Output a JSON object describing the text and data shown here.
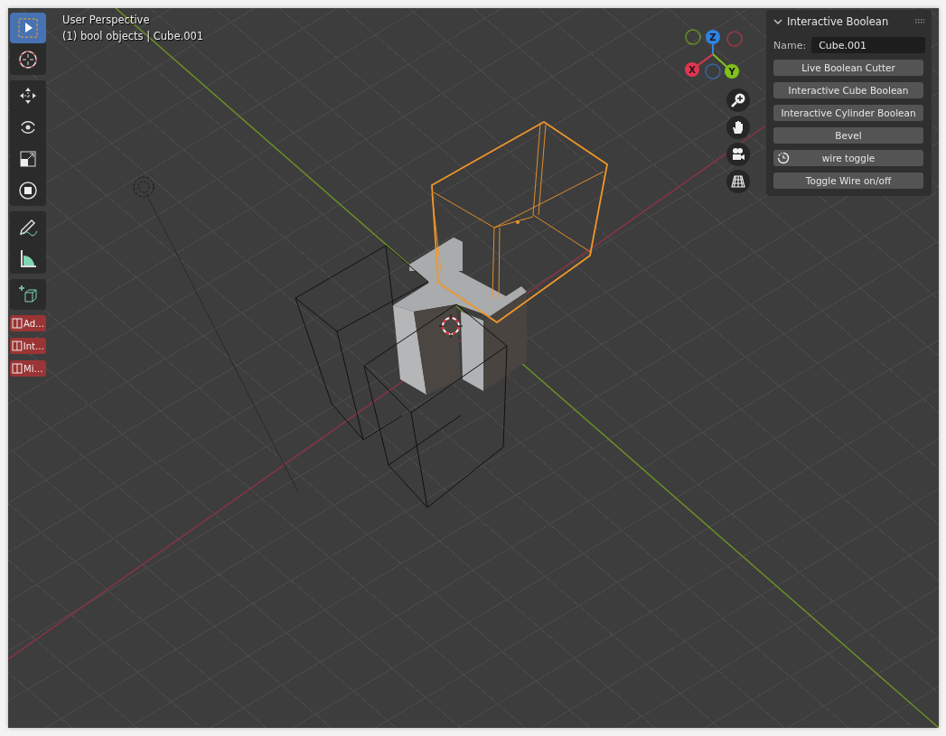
{
  "viewport": {
    "header": [
      "User Perspective",
      "(1) bool objects | Cube.001"
    ]
  },
  "toolbar": {
    "groups": [
      {
        "tools": [
          {
            "selected": true
          },
          {
            "selected": false
          }
        ]
      },
      {
        "tools": [
          {
            "selected": false
          },
          {
            "selected": false
          },
          {
            "selected": false
          },
          {
            "selected": false
          }
        ]
      },
      {
        "tools": [
          {
            "selected": false
          },
          {
            "selected": false
          }
        ]
      },
      {
        "tools": [
          {
            "selected": false
          }
        ]
      }
    ],
    "addons": [
      "Ad…",
      "Int…",
      "Mi…"
    ]
  },
  "gizmo": {
    "axes": [
      {
        "label": "Z",
        "color": "#2f83e3"
      },
      {
        "label": "X",
        "color": "#e2344f"
      },
      {
        "label": "Y",
        "color": "#80c11a"
      }
    ]
  },
  "panel": {
    "title": "Interactive Boolean",
    "expanded": true,
    "name_label": "Name:",
    "name_value": "Cube.001",
    "buttons": [
      {
        "kind": "plain",
        "label": "Live Boolean Cutter"
      },
      {
        "kind": "plain",
        "label": "Interactive Cube Boolean"
      },
      {
        "kind": "plain",
        "label": "Interactive Cylinder Boolean"
      },
      {
        "kind": "plain",
        "label": "Bevel"
      },
      {
        "kind": "icon",
        "label": "wire toggle"
      },
      {
        "kind": "plain",
        "label": "Toggle Wire on/off"
      }
    ]
  }
}
